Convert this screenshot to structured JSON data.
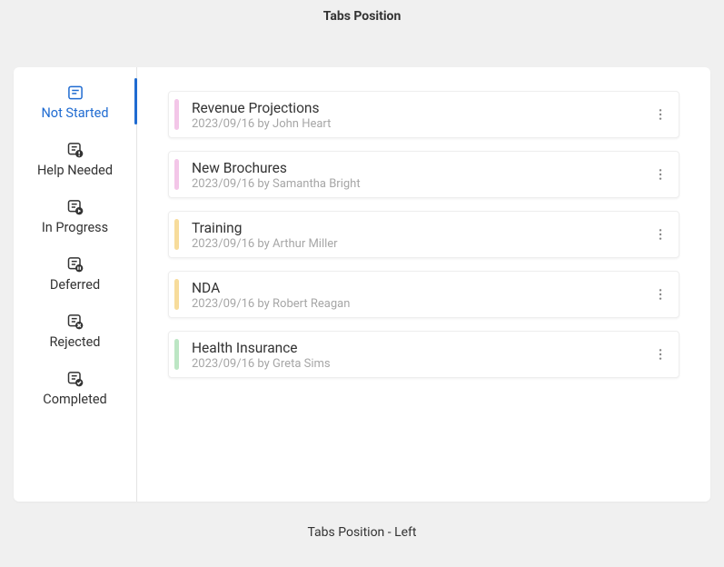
{
  "page_title": "Tabs Position",
  "footer_text": "Tabs Position - Left",
  "colors": {
    "accent": "#1f6bd1",
    "bar_pink": "#f3c6e8",
    "bar_yellow": "#f7dc9b",
    "bar_green": "#bce6c4"
  },
  "tabs": [
    {
      "label": "Not Started",
      "icon": "task-icon",
      "selected": true
    },
    {
      "label": "Help Needed",
      "icon": "task-alert-icon",
      "selected": false
    },
    {
      "label": "In Progress",
      "icon": "task-play-icon",
      "selected": false
    },
    {
      "label": "Deferred",
      "icon": "task-pause-icon",
      "selected": false
    },
    {
      "label": "Rejected",
      "icon": "task-reject-icon",
      "selected": false
    },
    {
      "label": "Completed",
      "icon": "task-check-icon",
      "selected": false
    }
  ],
  "tasks": [
    {
      "title": "Revenue Projections",
      "date": "2023/09/16",
      "by_label": "by",
      "author": "John Heart",
      "bar_color": "#f3c6e8"
    },
    {
      "title": "New Brochures",
      "date": "2023/09/16",
      "by_label": "by",
      "author": "Samantha Bright",
      "bar_color": "#f3c6e8"
    },
    {
      "title": "Training",
      "date": "2023/09/16",
      "by_label": "by",
      "author": "Arthur Miller",
      "bar_color": "#f7dc9b"
    },
    {
      "title": "NDA",
      "date": "2023/09/16",
      "by_label": "by",
      "author": "Robert Reagan",
      "bar_color": "#f7dc9b"
    },
    {
      "title": "Health Insurance",
      "date": "2023/09/16",
      "by_label": "by",
      "author": "Greta Sims",
      "bar_color": "#bce6c4"
    }
  ]
}
